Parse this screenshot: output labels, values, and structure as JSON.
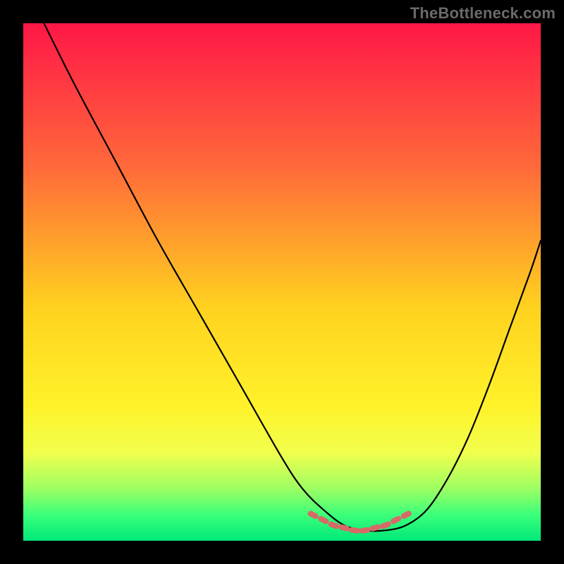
{
  "watermark": "TheBottleneck.com",
  "colors": {
    "frame": "#000000",
    "gradient_stops": [
      {
        "offset": 0.0,
        "color": "#ff1747"
      },
      {
        "offset": 0.28,
        "color": "#ff6a3a"
      },
      {
        "offset": 0.55,
        "color": "#ffd21f"
      },
      {
        "offset": 0.74,
        "color": "#fff22a"
      },
      {
        "offset": 0.83,
        "color": "#f1ff4d"
      },
      {
        "offset": 0.9,
        "color": "#9cff63"
      },
      {
        "offset": 0.95,
        "color": "#3bff7a"
      },
      {
        "offset": 1.0,
        "color": "#00e87a"
      }
    ],
    "curve": "#000000",
    "marker": "#d66a66"
  },
  "chart_data": {
    "type": "line",
    "title": "",
    "xlabel": "",
    "ylabel": "",
    "xlim": [
      0,
      100
    ],
    "ylim": [
      0,
      100
    ],
    "grid": false,
    "legend": false,
    "series": [
      {
        "name": "curve",
        "x": [
          4,
          10,
          18,
          26,
          34,
          42,
          50,
          54,
          58,
          62,
          66,
          70,
          74,
          78,
          82,
          86,
          90,
          94,
          98,
          100
        ],
        "y": [
          100,
          88,
          73,
          58,
          44,
          30,
          16,
          10,
          6,
          3,
          2,
          2,
          3,
          6,
          12,
          20,
          30,
          41,
          52,
          58
        ]
      }
    ],
    "markers": {
      "name": "highlight",
      "x": [
        56,
        58,
        60,
        62,
        64,
        66,
        68,
        70,
        72,
        74
      ],
      "y": [
        5,
        4,
        3,
        2.5,
        2,
        2,
        2.5,
        3,
        4,
        5
      ]
    }
  }
}
